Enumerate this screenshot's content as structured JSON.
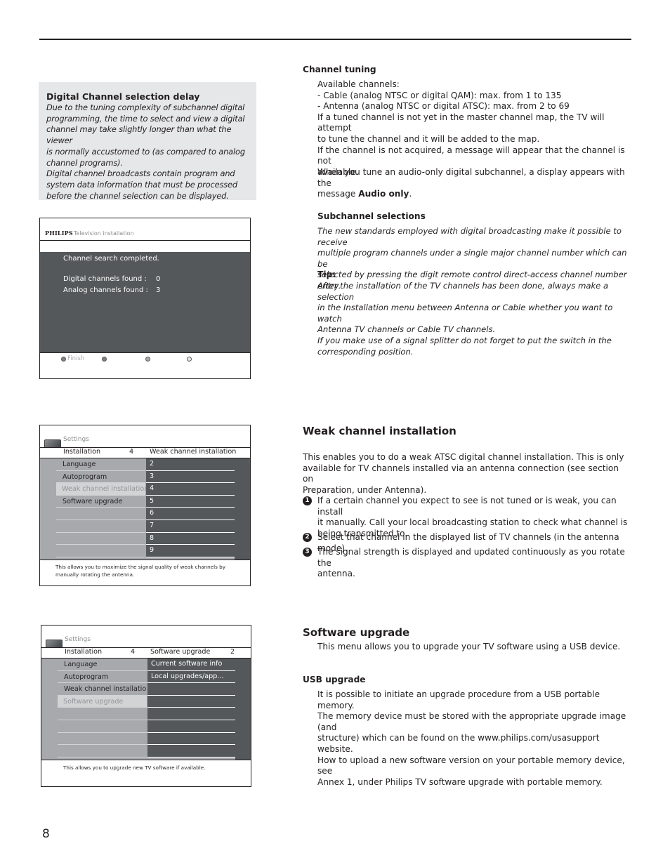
{
  "page_number": "8",
  "note_box": {
    "title": "Digital Channel selection delay",
    "body": "Due to the tuning complexity of subchannel digital\nprogramming, the time to select and view a digital\nchannel may take slightly longer than what the viewer\nis normally accustomed to (as compared to analog\nchannel programs).\nDigital channel broadcasts contain program and\nsystem data information that must be processed\nbefore the channel selection can be displayed."
  },
  "screen_install": {
    "brand": "PHILIPS",
    "header": "Television installation",
    "message": "Channel search completed.",
    "rows": [
      {
        "label": "Digital channels found :",
        "value": "0"
      },
      {
        "label": "Analog channels found :",
        "value": "3"
      }
    ],
    "footer_button": "Finish",
    "dot_colors": [
      "#808285",
      "#808285",
      "#a7a9ac",
      "#e6e7e8"
    ]
  },
  "screen_weak": {
    "title": "Settings",
    "bar_left": "Installation",
    "bar_left_num": "4",
    "bar_right": "Weak channel installation",
    "bar_right_num": "",
    "menu": [
      "Language",
      "Autoprogram",
      "Weak channel installation",
      "Software upgrade",
      "",
      "",
      "",
      ""
    ],
    "selected_index": 2,
    "list": [
      "2",
      "3",
      "4",
      "5",
      "6",
      "7",
      "8",
      "9"
    ],
    "description": "This allows you to maximize the signal quality of weak channels by manually rotating the antenna."
  },
  "screen_software": {
    "title": "Settings",
    "bar_left": "Installation",
    "bar_left_num": "4",
    "bar_right": "Software upgrade",
    "bar_right_num": "2",
    "menu": [
      "Language",
      "Autoprogram",
      "Weak channel installation",
      "Software upgrade",
      "",
      "",
      "",
      ""
    ],
    "selected_index": 3,
    "list": [
      "Current software info",
      "Local upgrades/app...",
      "",
      "",
      "",
      "",
      "",
      ""
    ],
    "description": "This allows you to upgrade new TV software if available."
  },
  "channel_tuning": {
    "heading": "Channel tuning",
    "body": "Available channels:\n- Cable (analog NTSC or digital QAM): max. from 1 to 135\n- Antenna (analog NTSC or digital ATSC): max. from 2 to 69\nIf a tuned channel is not yet in the master channel map, the TV will attempt\nto tune the channel and it will be added to the map.\nIf the channel is not acquired, a message will appear that the channel is not\navailable.",
    "audio_prefix": "When you tune an audio-only digital subchannel, a display appears with the\nmessage ",
    "audio_bold": "Audio only",
    "audio_suffix": "."
  },
  "subchannel": {
    "heading": "Subchannel selections",
    "body": "The new standards employed with digital broadcasting make it possible to receive\nmultiple program channels under a single major channel number which can be\nselected by pressing the digit remote control direct-access channel number entry."
  },
  "tip": {
    "heading": "Tip:",
    "body": "After the installation of the TV channels has been done, always make a selection\nin the Installation menu between Antenna or Cable whether you want to watch\nAntenna TV channels or Cable TV channels.\nIf you make use of a signal splitter do not forget to put the switch in the\ncorresponding position."
  },
  "weak_channel": {
    "heading": "Weak channel installation",
    "intro": "This enables you to do a weak ATSC digital channel installation. This is only\navailable for TV channels installed via an antenna connection (see section on\nPreparation, under Antenna).",
    "steps": [
      {
        "num": "1",
        "text": "If a certain channel you expect to see is not tuned or is weak, you can install\nit manually. Call your local broadcasting station to check what channel is\nbeing transmitted to."
      },
      {
        "num": "2",
        "text": "Select that channel in the displayed list of TV channels (in the antenna mode)."
      },
      {
        "num": "3",
        "text": "The signal strength is displayed and updated continuously as you rotate the\nantenna."
      }
    ]
  },
  "software_upgrade": {
    "heading": "Software upgrade",
    "intro": "This menu allows you to upgrade your TV software using a USB device.",
    "usb_heading": "USB upgrade",
    "usb_body": "It is possible to initiate an upgrade procedure from a USB portable memory.\nThe memory device must be stored with the appropriate upgrade image (and\nstructure) which can be found on the www.philips.com/usasupport website.\nHow to upload a new software version on your portable memory device, see\nAnnex 1, under Philips TV software upgrade with portable memory."
  }
}
